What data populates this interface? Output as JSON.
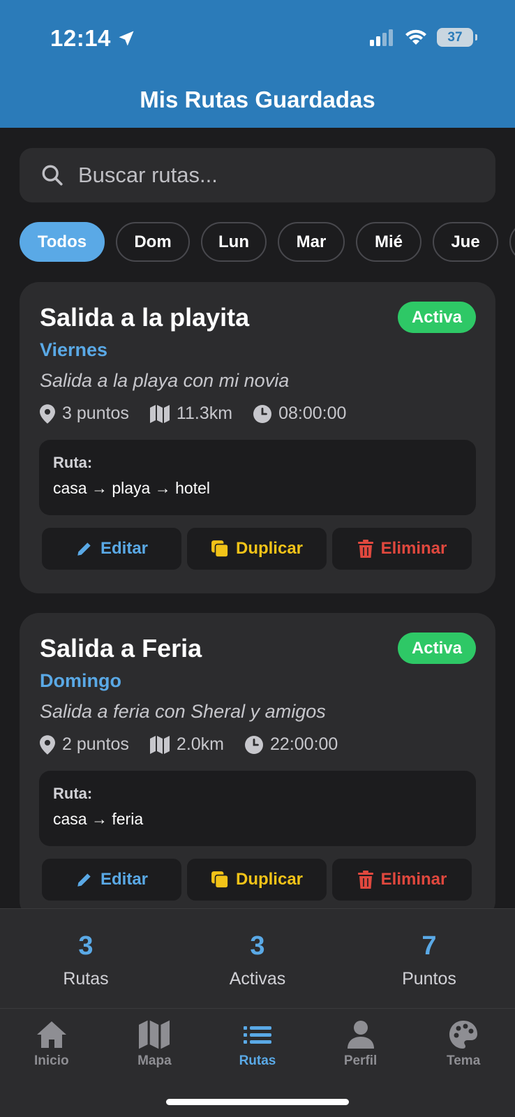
{
  "status_bar": {
    "time": "12:14",
    "battery": "37"
  },
  "header": {
    "title": "Mis Rutas Guardadas"
  },
  "search": {
    "placeholder": "Buscar rutas..."
  },
  "filters": [
    {
      "label": "Todos",
      "active": true
    },
    {
      "label": "Dom",
      "active": false
    },
    {
      "label": "Lun",
      "active": false
    },
    {
      "label": "Mar",
      "active": false
    },
    {
      "label": "Mié",
      "active": false
    },
    {
      "label": "Jue",
      "active": false
    }
  ],
  "routes": [
    {
      "title": "Salida a la playita",
      "status": "Activa",
      "day": "Viernes",
      "description": "Salida a la playa con mi novia",
      "points": "3 puntos",
      "distance": "11.3km",
      "time": "08:00:00",
      "route_label": "Ruta:",
      "route_path": "casa → playa → hotel",
      "edit_label": "Editar",
      "duplicate_label": "Duplicar",
      "delete_label": "Eliminar"
    },
    {
      "title": "Salida a Feria",
      "status": "Activa",
      "day": "Domingo",
      "description": "Salida a feria con Sheral y amigos",
      "points": "2 puntos",
      "distance": "2.0km",
      "time": "22:00:00",
      "route_label": "Ruta:",
      "route_path": "casa → feria",
      "edit_label": "Editar",
      "duplicate_label": "Duplicar",
      "delete_label": "Eliminar"
    }
  ],
  "stats": [
    {
      "value": "3",
      "label": "Rutas"
    },
    {
      "value": "3",
      "label": "Activas"
    },
    {
      "value": "7",
      "label": "Puntos"
    }
  ],
  "tabs": [
    {
      "label": "Inicio",
      "icon": "home-icon",
      "active": false
    },
    {
      "label": "Mapa",
      "icon": "map-icon",
      "active": false
    },
    {
      "label": "Rutas",
      "icon": "list-icon",
      "active": true
    },
    {
      "label": "Perfil",
      "icon": "user-icon",
      "active": false
    },
    {
      "label": "Tema",
      "icon": "palette-icon",
      "active": false
    }
  ],
  "colors": {
    "header": "#2b7bb9",
    "accent": "#5aa9e6",
    "active_badge": "#2ec866",
    "duplicate": "#f2c318",
    "delete": "#e0483e"
  }
}
